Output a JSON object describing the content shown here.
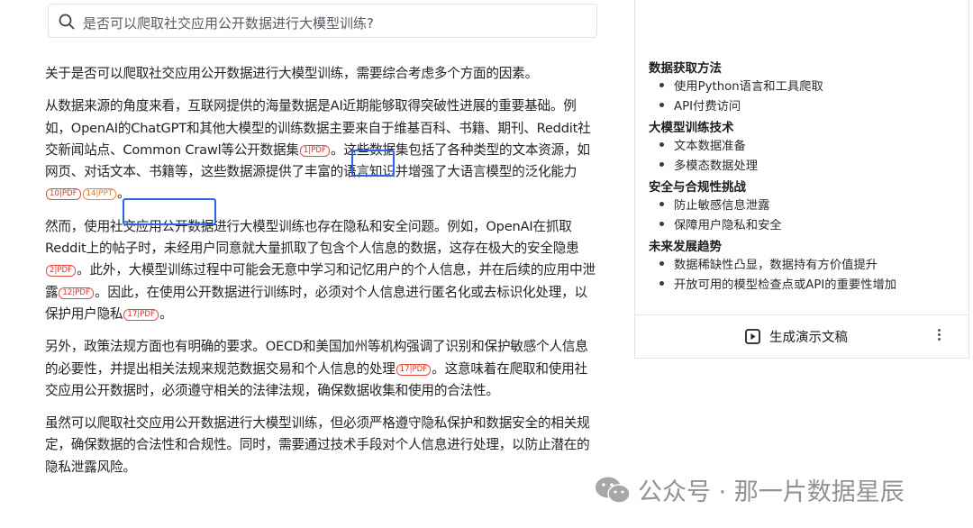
{
  "search": {
    "query": "是否可以爬取社交应用公开数据进行大模型训练?"
  },
  "answer": {
    "p1": {
      "t1": "关于是否可以爬取社交应用公开数据进行大模型训练，需要综合考虑多个方面的因素。"
    },
    "p2": {
      "t1": "从数据来源的角度来看，互联网提供的海量数据是AI近期能够取得突破性进展的重要基础。例如，OpenAI的ChatGPT和其他大模型的训练数据主要来自于维基百科、书籍、期刊、Reddit社交新闻站点、Common Crawl等公开数据集",
      "c1": "1|PDF",
      "t2": "。这些数据集包括了各种类型的文本资源，如网页、对话文本、书籍等，这些数据源提供了丰富的语言知识并增强了大语言模型的泛化能力",
      "c2": "10|PDF",
      "c3": "14|PPT",
      "t3": "。"
    },
    "p3": {
      "t1": "然而，使用社交应用公开数据进行大模型训练也存在隐私和安全问题。例如，OpenAI在抓取Reddit上的帖子时，未经用户同意就大量抓取了包含个人信息的数据，这存在极大的安全隐患",
      "c1": "2|PDF",
      "t2": "。此外，大模型训练过程中可能会无意中学习和记忆用户的个人信息，并在后续的应用中泄露",
      "c2": "12|PDF",
      "t3": "。因此，在使用公开数据进行训练时，必须对个人信息进行匿名化或去标识化处理，以保护用户隐私",
      "c3": "17|PDF",
      "t4": "。"
    },
    "p4": {
      "t1": "另外，政策法规方面也有明确的要求。OECD和美国加州等机构强调了识别和保护敏感个人信息的必要性，并提出相关法规来规范数据交易和个人信息的处理",
      "c1": "17|PDF",
      "t2": "。这意味着在爬取和使用社交应用公开数据时，必须遵守相关的法律法规，确保数据收集和使用的合法性。"
    },
    "p5": {
      "t1": "虽然可以爬取社交应用公开数据进行大模型训练，但必须严格遵守隐私保护和数据安全的相关规定，确保数据的合法性和合规性。同时，需要通过技术手段对个人信息进行处理，以防止潜在的隐私泄露风险。"
    }
  },
  "outline": {
    "sections": [
      {
        "title": "数据获取方法",
        "items": [
          "使用Python语言和工具爬取",
          "API付费访问"
        ]
      },
      {
        "title": "大模型训练技术",
        "items": [
          "文本数据准备",
          "多模态数据处理"
        ]
      },
      {
        "title": "安全与合规性挑战",
        "items": [
          "防止敏感信息泄露",
          "保障用户隐私和安全"
        ]
      },
      {
        "title": "未来发展趋势",
        "items": [
          "数据稀缺性凸显，数据持有方价值提升",
          "开放可用的模型检查点或API的重要性增加"
        ]
      }
    ],
    "generate_label": "生成演示文稿"
  },
  "watermark": {
    "text": "公众号 · 那一片数据星辰"
  },
  "colors": {
    "highlight": "#2f63ea",
    "cite_pdf": "#e94a3e",
    "cite_ppt": "#e8883a"
  }
}
